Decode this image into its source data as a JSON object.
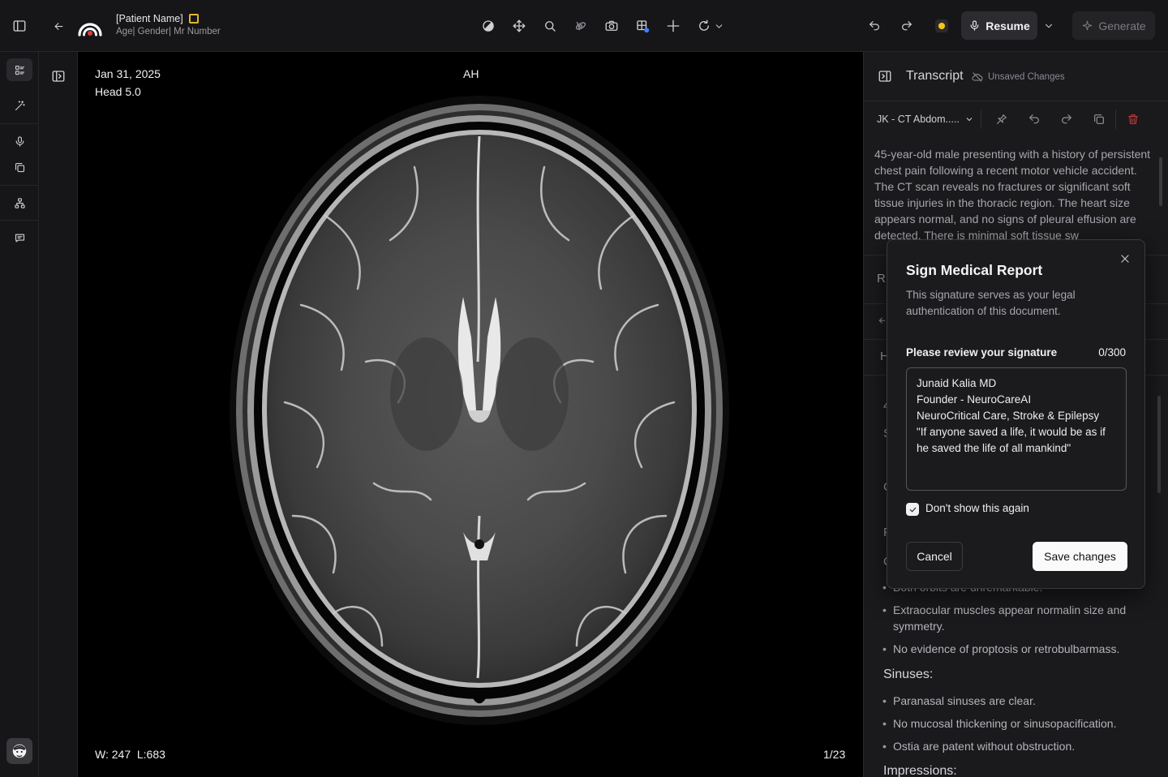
{
  "header": {
    "patient_name": "[Patient Name]",
    "patient_meta": "Age| Gender| Mr Number",
    "resume_label": "Resume",
    "generate_label": "Generate",
    "status_color": "#f5c518",
    "icons": [
      "sidebar-toggle-icon",
      "back-arrow-icon",
      "logo",
      "contrast-icon",
      "pan-icon",
      "zoom-icon",
      "rotate-3d-icon",
      "camera-icon",
      "layout-grid-icon",
      "crosshair-icon",
      "reset-icon",
      "chevron-down-icon",
      "undo-icon",
      "redo-icon",
      "microphone-icon",
      "sparkle-icon"
    ]
  },
  "rail": {
    "items": [
      "layout-list-icon",
      "magic-wand-icon",
      "microphone-icon",
      "copy-icon",
      "hierarchy-icon",
      "chat-icon"
    ]
  },
  "viewer": {
    "date": "Jan 31, 2025",
    "series": "Head 5.0",
    "orientation": "AH",
    "window_level": "W: 247  L:683",
    "slice": "1/23"
  },
  "panel": {
    "title": "Transcript",
    "unsaved": "Unsaved Changes",
    "template": "JK - CT Abdom.....",
    "transcript": "45-year-old male presenting with a history of persistent chest pain following a recent motor vehicle accident. The CT scan reveals no fractures or significant soft tissue injuries in the thoracic region. The heart size appears normal, and no signs of pleural effusion are detected. There is minimal soft tissue sw",
    "ghost_letters": [
      "R",
      "H",
      "4",
      "S",
      "C",
      "F",
      "C"
    ],
    "hidden_bullet": "Both orbits are unremarkable.",
    "orbit_bullets": [
      "Extraocular muscles appear normalin size and symmetry.",
      "No evidence of proptosis or retrobulbarmass."
    ],
    "sinuses_heading": "Sinuses:",
    "sinus_bullets": [
      "Paranasal sinuses are clear.",
      "No mucosal thickening or sinusopacification.",
      "Ostia are patent without obstruction."
    ],
    "impressions_heading": "Impressions:"
  },
  "modal": {
    "title": "Sign Medical Report",
    "description": "This signature serves as your legal authentication of this document.",
    "signature_label": "Please review your signature",
    "signature_count": "0/300",
    "signature_text": "Junaid Kalia MD\nFounder - NeuroCareAI\nNeuroCritical Care, Stroke & Epilepsy\n\"If anyone saved a life, it would be as if he saved the life of all mankind\"",
    "checkbox_label": "Don't show this again",
    "checkbox_checked": true,
    "cancel_label": "Cancel",
    "save_label": "Save changes"
  }
}
